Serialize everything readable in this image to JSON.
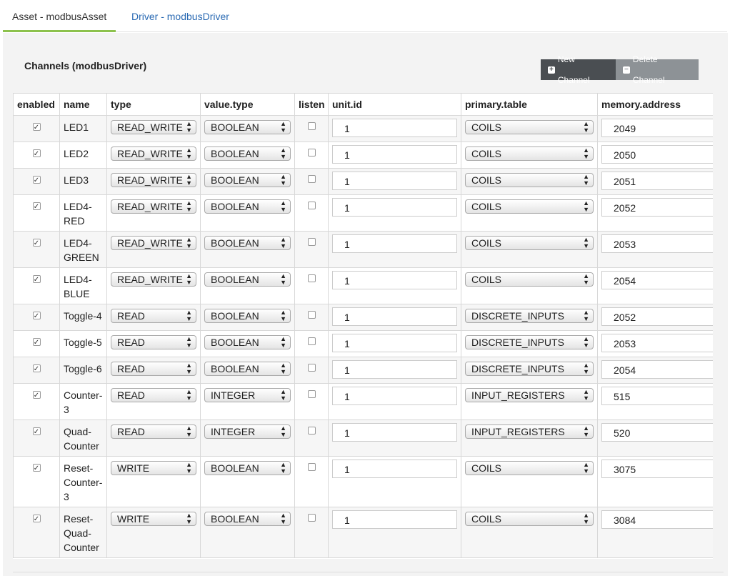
{
  "tabs": [
    {
      "label": "Asset - modbusAsset",
      "active": true
    },
    {
      "label": "Driver - modbusDriver",
      "active": false
    }
  ],
  "panel": {
    "title": "Channels (modbusDriver)",
    "new_channel_label": "New Channel",
    "delete_channel_label": "Delete Channel"
  },
  "table": {
    "headers": [
      "enabled",
      "name",
      "type",
      "value.type",
      "listen",
      "unit.id",
      "primary.table",
      "memory.address"
    ],
    "rows": [
      {
        "enabled": true,
        "name": "LED1",
        "type": "READ_WRITE",
        "value_type": "BOOLEAN",
        "listen": false,
        "unit_id": "1",
        "primary_table": "COILS",
        "memory_address": "2049"
      },
      {
        "enabled": true,
        "name": "LED2",
        "type": "READ_WRITE",
        "value_type": "BOOLEAN",
        "listen": false,
        "unit_id": "1",
        "primary_table": "COILS",
        "memory_address": "2050"
      },
      {
        "enabled": true,
        "name": "LED3",
        "type": "READ_WRITE",
        "value_type": "BOOLEAN",
        "listen": false,
        "unit_id": "1",
        "primary_table": "COILS",
        "memory_address": "2051"
      },
      {
        "enabled": true,
        "name": "LED4-RED",
        "type": "READ_WRITE",
        "value_type": "BOOLEAN",
        "listen": false,
        "unit_id": "1",
        "primary_table": "COILS",
        "memory_address": "2052"
      },
      {
        "enabled": true,
        "name": "LED4-GREEN",
        "type": "READ_WRITE",
        "value_type": "BOOLEAN",
        "listen": false,
        "unit_id": "1",
        "primary_table": "COILS",
        "memory_address": "2053"
      },
      {
        "enabled": true,
        "name": "LED4-BLUE",
        "type": "READ_WRITE",
        "value_type": "BOOLEAN",
        "listen": false,
        "unit_id": "1",
        "primary_table": "COILS",
        "memory_address": "2054"
      },
      {
        "enabled": true,
        "name": "Toggle-4",
        "type": "READ",
        "value_type": "BOOLEAN",
        "listen": false,
        "unit_id": "1",
        "primary_table": "DISCRETE_INPUTS",
        "memory_address": "2052"
      },
      {
        "enabled": true,
        "name": "Toggle-5",
        "type": "READ",
        "value_type": "BOOLEAN",
        "listen": false,
        "unit_id": "1",
        "primary_table": "DISCRETE_INPUTS",
        "memory_address": "2053"
      },
      {
        "enabled": true,
        "name": "Toggle-6",
        "type": "READ",
        "value_type": "BOOLEAN",
        "listen": false,
        "unit_id": "1",
        "primary_table": "DISCRETE_INPUTS",
        "memory_address": "2054"
      },
      {
        "enabled": true,
        "name": "Counter-3",
        "type": "READ",
        "value_type": "INTEGER",
        "listen": false,
        "unit_id": "1",
        "primary_table": "INPUT_REGISTERS",
        "memory_address": "515"
      },
      {
        "enabled": true,
        "name": "Quad-Counter",
        "type": "READ",
        "value_type": "INTEGER",
        "listen": false,
        "unit_id": "1",
        "primary_table": "INPUT_REGISTERS",
        "memory_address": "520"
      },
      {
        "enabled": true,
        "name": "Reset-Counter-3",
        "type": "WRITE",
        "value_type": "BOOLEAN",
        "listen": false,
        "unit_id": "1",
        "primary_table": "COILS",
        "memory_address": "3075"
      },
      {
        "enabled": true,
        "name": "Reset-Quad-Counter",
        "type": "WRITE",
        "value_type": "BOOLEAN",
        "listen": false,
        "unit_id": "1",
        "primary_table": "COILS",
        "memory_address": "3084"
      }
    ]
  },
  "colors": {
    "active_tab_underline": "#8cc14c",
    "link": "#2a6ab3",
    "new_button": "#4a4e52",
    "delete_button": "#8d9296"
  },
  "icons": {
    "new_button_icon": "plus-square-icon",
    "delete_button_icon": "minus-square-icon",
    "select_arrow": "updown-arrow-icon",
    "checkbox": "checkbox-icon"
  }
}
